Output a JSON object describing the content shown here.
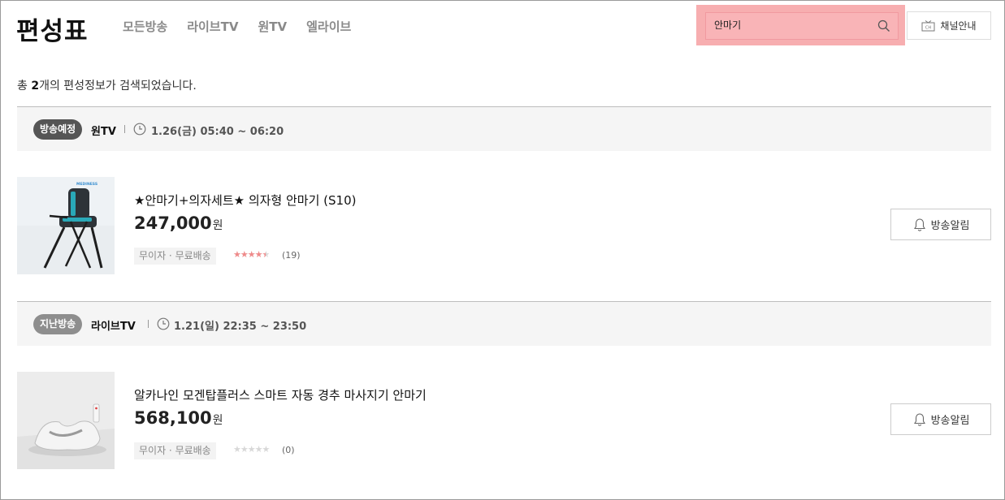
{
  "header": {
    "logo": "편성표",
    "nav": [
      "모든방송",
      "라이브TV",
      "원TV",
      "엘라이브"
    ],
    "search_value": "안마기",
    "channel_guide": "채널안내"
  },
  "summary": {
    "prefix": "총 ",
    "count": "2",
    "suffix": "개의 편성정보가 검색되었습니다."
  },
  "groups": [
    {
      "badge": "방송예정",
      "channel": "원TV",
      "time": "1.26(금) 05:40 ~ 06:20",
      "product": {
        "name": "★안마기+의자세트★ 의자형 안마기 (S10)",
        "price": "247,000",
        "unit": "원",
        "tags": "무이자 · 무료배송",
        "rating": 4.5,
        "review_count": "(19)",
        "image_brand": "MEDINESS"
      },
      "alarm": "방송알림"
    },
    {
      "badge": "지난방송",
      "channel": "라이브TV",
      "time": "1.21(일) 22:35 ~ 23:50",
      "product": {
        "name": "알카나인 모겐탑플러스 스마트 자동 경추 마사지기 안마기",
        "price": "568,100",
        "unit": "원",
        "tags": "무이자 · 무료배송",
        "rating": 0,
        "review_count": "(0)"
      },
      "alarm": "방송알림"
    }
  ],
  "colors": {
    "search_highlight": "#f7aeb0",
    "star_filled": "#ee8a8a",
    "star_empty": "#d8d8d8",
    "badge_upcoming": "#555555",
    "badge_past": "#8e8e8e"
  }
}
